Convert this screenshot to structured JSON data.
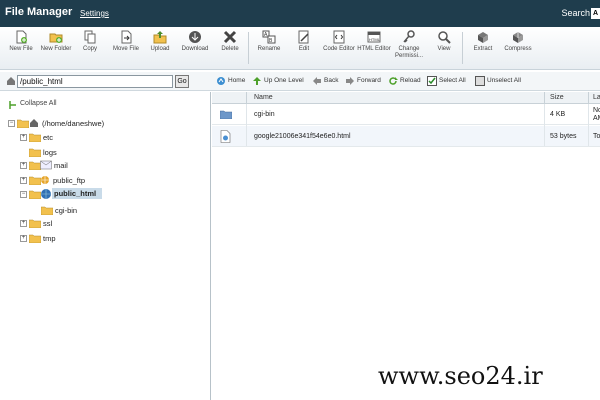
{
  "header": {
    "title": "File Manager",
    "settings_label": "Settings",
    "search_label": "Search",
    "search_box_text": "A"
  },
  "toolbar": {
    "items": [
      {
        "label": "New File",
        "icon": "new-file-icon"
      },
      {
        "label": "New Folder",
        "icon": "new-folder-icon"
      },
      {
        "label": "Copy",
        "icon": "copy-icon"
      },
      {
        "label": "Move File",
        "icon": "move-file-icon"
      },
      {
        "label": "Upload",
        "icon": "upload-icon"
      },
      {
        "label": "Download",
        "icon": "download-icon"
      },
      {
        "label": "Delete",
        "icon": "delete-icon"
      },
      {
        "label": "Rename",
        "icon": "rename-icon"
      },
      {
        "label": "Edit",
        "icon": "edit-icon"
      },
      {
        "label": "Code Editor",
        "icon": "code-editor-icon"
      },
      {
        "label": "HTML Editor",
        "icon": "html-editor-icon"
      },
      {
        "label": "Change Permissi...",
        "icon": "permissions-icon"
      },
      {
        "label": "View",
        "icon": "view-icon"
      },
      {
        "label": "Extract",
        "icon": "extract-icon"
      },
      {
        "label": "Compress",
        "icon": "compress-icon"
      }
    ]
  },
  "pathbar": {
    "path_value": "/public_html",
    "go_label": "Go",
    "nav": [
      {
        "label": "Home"
      },
      {
        "label": "Up One Level"
      },
      {
        "label": "Back"
      },
      {
        "label": "Forward"
      },
      {
        "label": "Reload"
      },
      {
        "label": "Select All"
      },
      {
        "label": "Unselect All"
      }
    ]
  },
  "tree": {
    "collapse_all": "Collapse All",
    "root": "(/home/daneshwe)",
    "items": [
      {
        "label": "etc"
      },
      {
        "label": "logs"
      },
      {
        "label": "mail"
      },
      {
        "label": "public_ftp"
      },
      {
        "label": "public_html"
      },
      {
        "label": "cgi-bin"
      },
      {
        "label": "ssl"
      },
      {
        "label": "tmp"
      }
    ]
  },
  "table": {
    "columns": [
      "Name",
      "Size",
      "La"
    ],
    "rows": [
      {
        "name": "cgi-bin",
        "size": "4 KB",
        "last_a": "No",
        "last_b": "AM"
      },
      {
        "name": "google21006e341f54e6e0.html",
        "size": "53 bytes",
        "last_a": "To",
        "last_b": ""
      }
    ]
  },
  "watermark": "www.seo24.ir",
  "colors": {
    "header_bg": "#1f3d4d",
    "selected_bg": "#c9dbe9",
    "folder": "#f2c14e"
  }
}
